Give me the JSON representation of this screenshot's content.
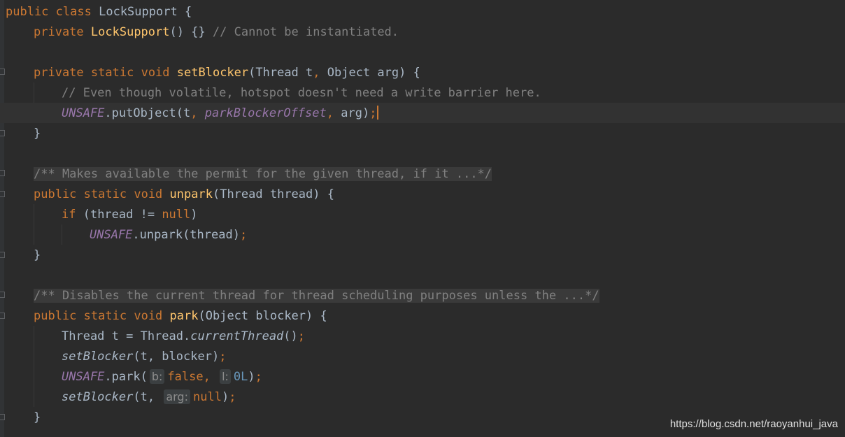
{
  "code": {
    "l1": {
      "kw1": "public",
      "kw2": "class",
      "name": "LockSupport",
      "brace": "{"
    },
    "l2": {
      "kw": "private",
      "fn": "LockSupport",
      "rest": "() {} ",
      "comment": "// Cannot be instantiated."
    },
    "l4": {
      "kw1": "private",
      "kw2": "static",
      "kw3": "void",
      "fn": "setBlocker",
      "p1": "(Thread t",
      "comma": ",",
      "p2": " Object arg) {"
    },
    "l5": {
      "comment": "// Even though volatile, hotspot doesn't need a write barrier here."
    },
    "l6": {
      "field": "UNSAFE",
      "call": ".putObject(t",
      "comma1": ",",
      "field2": "parkBlockerOffset",
      "comma2": ",",
      "arg": " arg)",
      "semi": ";"
    },
    "l7": {
      "brace": "}"
    },
    "l9": {
      "doc": "/** Makes available the permit for the given thread, if it ...*/"
    },
    "l10": {
      "kw1": "public",
      "kw2": "static",
      "kw3": "void",
      "fn": "unpark",
      "rest": "(Thread thread) {"
    },
    "l11": {
      "kw": "if",
      "cond": " (thread != ",
      "null": "null",
      "close": ")"
    },
    "l12": {
      "field": "UNSAFE",
      "call": ".unpark(thread)",
      "semi": ";"
    },
    "l13": {
      "brace": "}"
    },
    "l15": {
      "doc": "/** Disables the current thread for thread scheduling purposes unless the ...*/"
    },
    "l16": {
      "kw1": "public",
      "kw2": "static",
      "kw3": "void",
      "fn": "park",
      "rest": "(Object blocker) {"
    },
    "l17": {
      "pre": "Thread t = Thread.",
      "call": "currentThread",
      "post": "()",
      "semi": ";"
    },
    "l18": {
      "call": "setBlocker",
      "args": "(t, blocker)",
      "semi": ";"
    },
    "l19": {
      "field": "UNSAFE",
      "call": ".park(",
      "hint1": "b:",
      "v1": "false",
      "comma": ",",
      "hint2": "l:",
      "v2": "0L",
      "close": ")",
      "semi": ";"
    },
    "l20": {
      "call": "setBlocker",
      "args": "(t,",
      "hint": "arg:",
      "v": "null",
      "close": ")",
      "semi": ";"
    },
    "l21": {
      "brace": "}"
    }
  },
  "watermark": "https://blog.csdn.net/raoyanhui_java",
  "colors": {
    "background": "#2b2b2b",
    "keyword": "#cc7832",
    "function": "#ffc66d",
    "comment": "#808080",
    "field": "#9876aa",
    "number": "#6897bb",
    "text": "#a9b7c6"
  }
}
